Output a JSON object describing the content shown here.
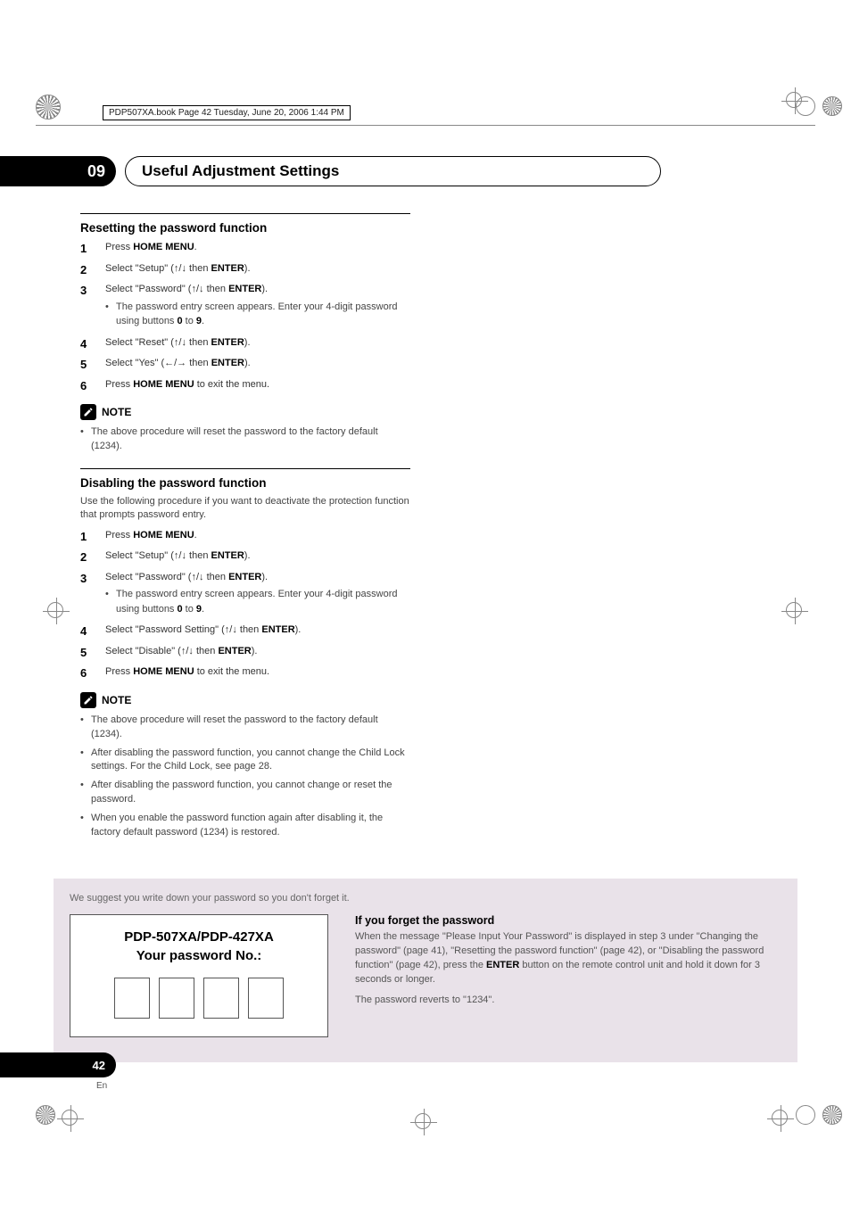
{
  "book_header": "PDP507XA.book  Page 42  Tuesday, June 20, 2006  1:44 PM",
  "chapter": {
    "number": "09",
    "title": "Useful Adjustment Settings"
  },
  "sections": [
    {
      "title": "Resetting the password function",
      "intro": "",
      "steps": [
        {
          "pre": "Press ",
          "bold": "HOME MENU",
          "post": "."
        },
        {
          "pre": "Select \"Setup\" (",
          "arrows": "↑/↓",
          "mid": " then ",
          "bold": "ENTER",
          "post": ")."
        },
        {
          "pre": "Select \"Password\" (",
          "arrows": "↑/↓",
          "mid": " then ",
          "bold": "ENTER",
          "post": ").",
          "sub": {
            "pre": "The password entry screen appears. Enter your 4-digit password using buttons ",
            "b1": "0",
            "mid": " to ",
            "b2": "9",
            "post": "."
          }
        },
        {
          "pre": "Select \"Reset\" (",
          "arrows": "↑/↓",
          "mid": " then ",
          "bold": "ENTER",
          "post": ")."
        },
        {
          "pre": "Select \"Yes\" (",
          "arrows": "←/→",
          "mid": " then ",
          "bold": "ENTER",
          "post": ")."
        },
        {
          "pre": "Press ",
          "bold": "HOME MENU",
          "post": " to exit the menu."
        }
      ],
      "note_label": "NOTE",
      "notes": [
        "The above procedure will reset the password to the factory default (1234)."
      ]
    },
    {
      "title": "Disabling the password function",
      "intro": "Use the following procedure if you want to deactivate the protection function that prompts password entry.",
      "steps": [
        {
          "pre": "Press ",
          "bold": "HOME MENU",
          "post": "."
        },
        {
          "pre": "Select \"Setup\" (",
          "arrows": "↑/↓",
          "mid": " then ",
          "bold": "ENTER",
          "post": ")."
        },
        {
          "pre": "Select \"Password\" (",
          "arrows": "↑/↓",
          "mid": " then ",
          "bold": "ENTER",
          "post": ").",
          "sub": {
            "pre": "The password entry screen appears. Enter your 4-digit password using buttons ",
            "b1": "0",
            "mid": " to ",
            "b2": "9",
            "post": "."
          }
        },
        {
          "pre": "Select \"Password Setting\" (",
          "arrows": "↑/↓",
          "mid": " then ",
          "bold": "ENTER",
          "post": ")."
        },
        {
          "pre": "Select \"Disable\" (",
          "arrows": "↑/↓",
          "mid": " then ",
          "bold": "ENTER",
          "post": ")."
        },
        {
          "pre": "Press ",
          "bold": "HOME MENU",
          "post": " to exit the menu."
        }
      ],
      "note_label": "NOTE",
      "notes": [
        "The above procedure will reset the password to the factory default (1234).",
        "After disabling the password function, you cannot change the Child Lock settings. For the Child Lock, see page 28.",
        "After disabling the password function, you cannot change or reset the password.",
        "When you enable the password function again after disabling it, the factory default password (1234) is restored."
      ]
    }
  ],
  "footer": {
    "suggest": "We suggest you write down your password so you don't forget it.",
    "card_title1": "PDP-507XA/PDP-427XA",
    "card_title2": "Your password No.:",
    "forget_title": "If you forget the password",
    "forget_body_pre": "When the message \"Please Input Your Password\" is displayed in step 3 under \"Changing the password\" (page 41), \"Resetting the password function\" (page 42), or \"Disabling the password function\" (page 42), press the ",
    "forget_body_bold": "ENTER",
    "forget_body_post": " button on the remote control unit and hold it down for 3 seconds or longer.",
    "forget_body2": "The password reverts to \"1234\"."
  },
  "page_number": "42",
  "page_lang": "En"
}
